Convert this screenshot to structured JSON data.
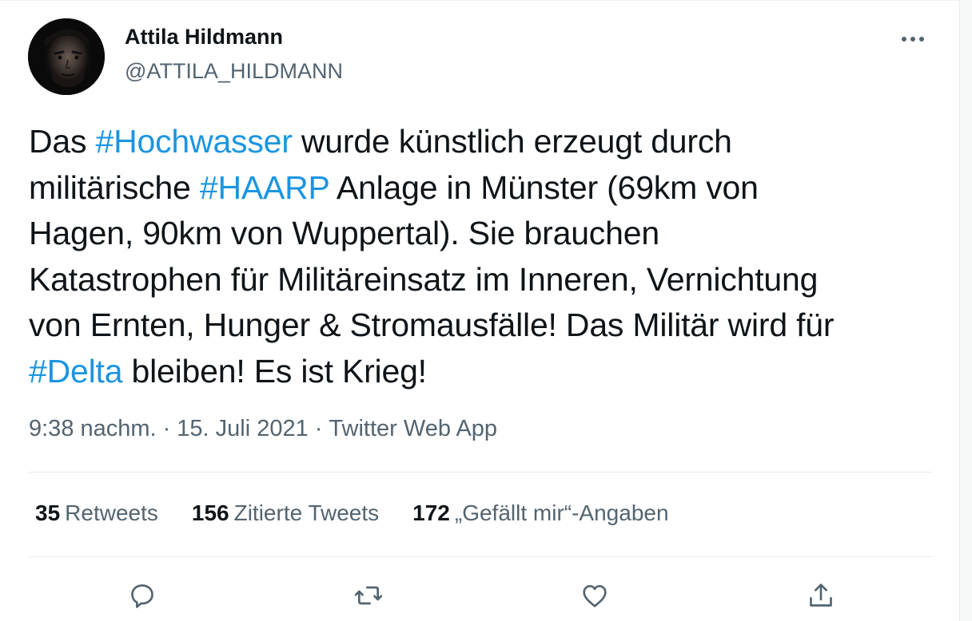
{
  "author": {
    "display_name": "Attila Hildmann",
    "handle": "@ATTILA_HILDMANN"
  },
  "tweet": {
    "lines": [
      [
        {
          "t": "Das "
        },
        {
          "t": "#Hochwasser",
          "tag": true
        },
        {
          "t": " wurde künstlich erzeugt durch"
        }
      ],
      [
        {
          "t": "militärische "
        },
        {
          "t": "#HAARP",
          "tag": true
        },
        {
          "t": " Anlage in Münster (69km von"
        }
      ],
      [
        {
          "t": "Hagen, 90km von Wuppertal). Sie brauchen"
        }
      ],
      [
        {
          "t": "Katastrophen für Militäreinsatz im Inneren, Vernichtung"
        }
      ],
      [
        {
          "t": "von Ernten, Hunger & Stromausfälle! Das Militär wird für"
        }
      ],
      [
        {
          "t": "#Delta",
          "tag": true
        },
        {
          "t": " bleiben! Es ist Krieg!"
        }
      ]
    ]
  },
  "meta": {
    "time": "9:38 nachm.",
    "separator": "·",
    "date": "15. Juli 2021",
    "source": "Twitter Web App"
  },
  "stats": {
    "retweets_count": "35",
    "retweets_label": "Retweets",
    "quotes_count": "156",
    "quotes_label": "Zitierte Tweets",
    "likes_count": "172",
    "likes_label": "„Gefällt mir“-Angaben"
  },
  "colors": {
    "hashtag": "#1b95e0",
    "secondary_text": "#536471",
    "primary_text": "#0f1419"
  },
  "icons": {
    "more": "more-icon",
    "reply": "reply-icon",
    "retweet": "retweet-icon",
    "like": "like-icon",
    "share": "share-icon"
  }
}
